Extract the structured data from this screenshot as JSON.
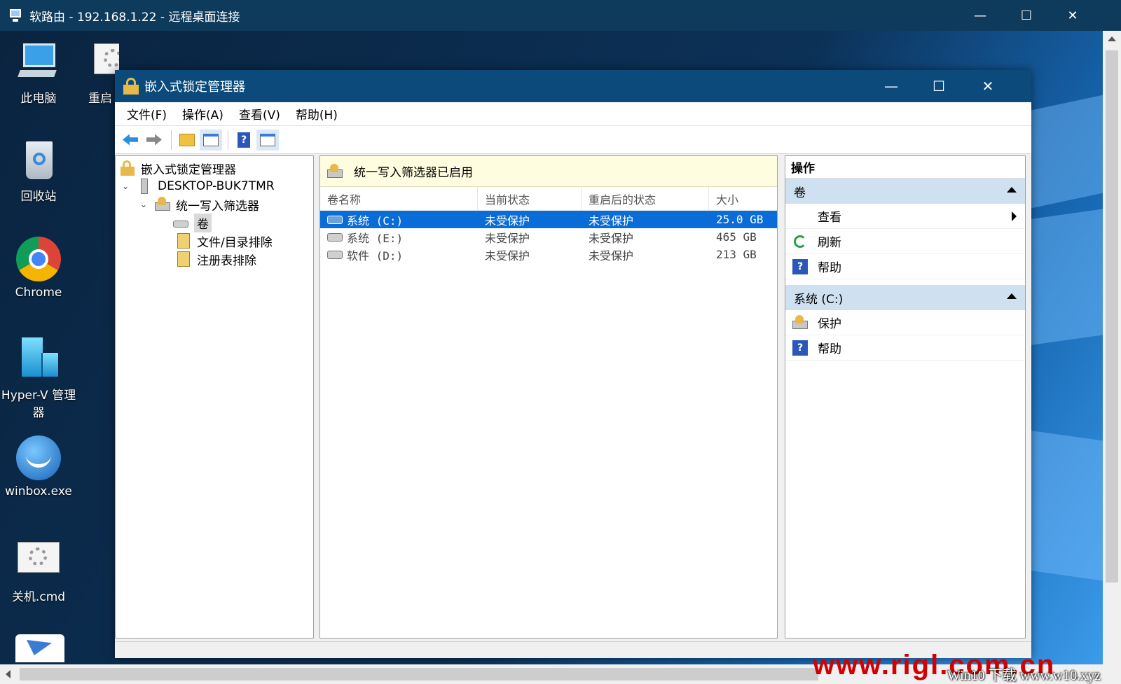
{
  "remote_desktop": {
    "title": "软路由 - 192.168.1.22 - 远程桌面连接",
    "controls": {
      "minimize": "—",
      "maximize": "☐",
      "close": "✕"
    }
  },
  "desktop": {
    "icons": [
      {
        "label": "此电脑",
        "icon": "computer-icon"
      },
      {
        "label": "重启",
        "icon": "gear-file-icon"
      },
      {
        "label": "回收站",
        "icon": "recycle-bin-icon"
      },
      {
        "label": "Chrome",
        "icon": "chrome-icon"
      },
      {
        "label": "Hyper-V 管理器",
        "icon": "hyperv-icon"
      },
      {
        "label": "winbox.exe",
        "icon": "winbox-icon"
      },
      {
        "label": "关机.cmd",
        "icon": "gear-file-icon"
      }
    ]
  },
  "mmc": {
    "title": "嵌入式锁定管理器",
    "controls": {
      "minimize": "—",
      "maximize": "☐",
      "close": "✕"
    },
    "menu": [
      "文件(F)",
      "操作(A)",
      "查看(V)",
      "帮助(H)"
    ],
    "toolbar": [
      "back-arrow-icon",
      "forward-arrow-icon",
      "up-folder-icon",
      "show-hide-tree-icon",
      "help-icon",
      "show-hide-action-icon"
    ],
    "tree": {
      "root": "嵌入式锁定管理器",
      "computer": "DESKTOP-BUK7TMR",
      "filter": "统一写入筛选器",
      "volumes": "卷",
      "file_exclusions": "文件/目录排除",
      "registry_exclusions": "注册表排除"
    },
    "list": {
      "banner": "统一写入筛选器已启用",
      "columns": [
        "卷名称",
        "当前状态",
        "重启后的状态",
        "大小"
      ],
      "rows": [
        {
          "name": "系统 (C:)",
          "current": "未受保护",
          "next": "未受保护",
          "size": "25.0 GB"
        },
        {
          "name": "系统 (E:)",
          "current": "未受保护",
          "next": "未受保护",
          "size": "465 GB"
        },
        {
          "name": "软件 (D:)",
          "current": "未受保护",
          "next": "未受保护",
          "size": "213 GB"
        }
      ]
    },
    "actions": {
      "title": "操作",
      "group1": {
        "label": "卷",
        "items": [
          "查看",
          "刷新",
          "帮助"
        ]
      },
      "group2": {
        "label": "系统 (C:)",
        "items": [
          "保护",
          "帮助"
        ]
      }
    }
  },
  "watermark": {
    "big": "www.rigl.com.cn",
    "small": "Win10 下载 www.w10.xyz"
  },
  "colors": {
    "selection": "#0a6cd6",
    "titlebar": "#0b4a7b",
    "banner": "#fffde0",
    "group_header": "#cfe0f0"
  }
}
